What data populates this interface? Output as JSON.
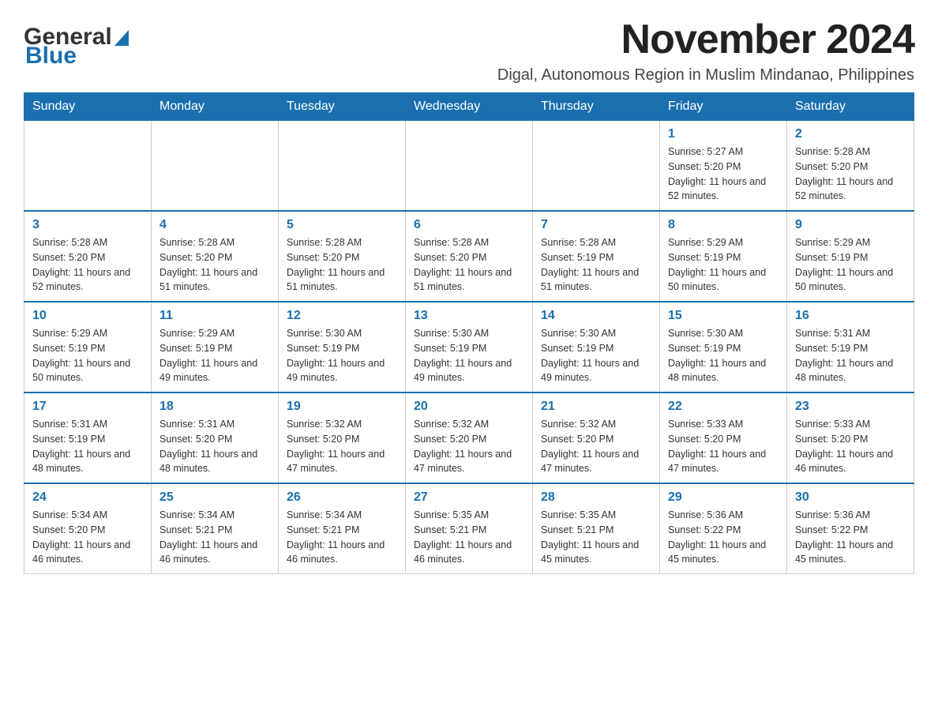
{
  "logo": {
    "line1": "General",
    "line2": "Blue"
  },
  "header": {
    "title": "November 2024",
    "subtitle": "Digal, Autonomous Region in Muslim Mindanao, Philippines"
  },
  "calendar": {
    "days_of_week": [
      "Sunday",
      "Monday",
      "Tuesday",
      "Wednesday",
      "Thursday",
      "Friday",
      "Saturday"
    ],
    "weeks": [
      [
        {
          "day": "",
          "info": ""
        },
        {
          "day": "",
          "info": ""
        },
        {
          "day": "",
          "info": ""
        },
        {
          "day": "",
          "info": ""
        },
        {
          "day": "",
          "info": ""
        },
        {
          "day": "1",
          "info": "Sunrise: 5:27 AM\nSunset: 5:20 PM\nDaylight: 11 hours and 52 minutes."
        },
        {
          "day": "2",
          "info": "Sunrise: 5:28 AM\nSunset: 5:20 PM\nDaylight: 11 hours and 52 minutes."
        }
      ],
      [
        {
          "day": "3",
          "info": "Sunrise: 5:28 AM\nSunset: 5:20 PM\nDaylight: 11 hours and 52 minutes."
        },
        {
          "day": "4",
          "info": "Sunrise: 5:28 AM\nSunset: 5:20 PM\nDaylight: 11 hours and 51 minutes."
        },
        {
          "day": "5",
          "info": "Sunrise: 5:28 AM\nSunset: 5:20 PM\nDaylight: 11 hours and 51 minutes."
        },
        {
          "day": "6",
          "info": "Sunrise: 5:28 AM\nSunset: 5:20 PM\nDaylight: 11 hours and 51 minutes."
        },
        {
          "day": "7",
          "info": "Sunrise: 5:28 AM\nSunset: 5:19 PM\nDaylight: 11 hours and 51 minutes."
        },
        {
          "day": "8",
          "info": "Sunrise: 5:29 AM\nSunset: 5:19 PM\nDaylight: 11 hours and 50 minutes."
        },
        {
          "day": "9",
          "info": "Sunrise: 5:29 AM\nSunset: 5:19 PM\nDaylight: 11 hours and 50 minutes."
        }
      ],
      [
        {
          "day": "10",
          "info": "Sunrise: 5:29 AM\nSunset: 5:19 PM\nDaylight: 11 hours and 50 minutes."
        },
        {
          "day": "11",
          "info": "Sunrise: 5:29 AM\nSunset: 5:19 PM\nDaylight: 11 hours and 49 minutes."
        },
        {
          "day": "12",
          "info": "Sunrise: 5:30 AM\nSunset: 5:19 PM\nDaylight: 11 hours and 49 minutes."
        },
        {
          "day": "13",
          "info": "Sunrise: 5:30 AM\nSunset: 5:19 PM\nDaylight: 11 hours and 49 minutes."
        },
        {
          "day": "14",
          "info": "Sunrise: 5:30 AM\nSunset: 5:19 PM\nDaylight: 11 hours and 49 minutes."
        },
        {
          "day": "15",
          "info": "Sunrise: 5:30 AM\nSunset: 5:19 PM\nDaylight: 11 hours and 48 minutes."
        },
        {
          "day": "16",
          "info": "Sunrise: 5:31 AM\nSunset: 5:19 PM\nDaylight: 11 hours and 48 minutes."
        }
      ],
      [
        {
          "day": "17",
          "info": "Sunrise: 5:31 AM\nSunset: 5:19 PM\nDaylight: 11 hours and 48 minutes."
        },
        {
          "day": "18",
          "info": "Sunrise: 5:31 AM\nSunset: 5:20 PM\nDaylight: 11 hours and 48 minutes."
        },
        {
          "day": "19",
          "info": "Sunrise: 5:32 AM\nSunset: 5:20 PM\nDaylight: 11 hours and 47 minutes."
        },
        {
          "day": "20",
          "info": "Sunrise: 5:32 AM\nSunset: 5:20 PM\nDaylight: 11 hours and 47 minutes."
        },
        {
          "day": "21",
          "info": "Sunrise: 5:32 AM\nSunset: 5:20 PM\nDaylight: 11 hours and 47 minutes."
        },
        {
          "day": "22",
          "info": "Sunrise: 5:33 AM\nSunset: 5:20 PM\nDaylight: 11 hours and 47 minutes."
        },
        {
          "day": "23",
          "info": "Sunrise: 5:33 AM\nSunset: 5:20 PM\nDaylight: 11 hours and 46 minutes."
        }
      ],
      [
        {
          "day": "24",
          "info": "Sunrise: 5:34 AM\nSunset: 5:20 PM\nDaylight: 11 hours and 46 minutes."
        },
        {
          "day": "25",
          "info": "Sunrise: 5:34 AM\nSunset: 5:21 PM\nDaylight: 11 hours and 46 minutes."
        },
        {
          "day": "26",
          "info": "Sunrise: 5:34 AM\nSunset: 5:21 PM\nDaylight: 11 hours and 46 minutes."
        },
        {
          "day": "27",
          "info": "Sunrise: 5:35 AM\nSunset: 5:21 PM\nDaylight: 11 hours and 46 minutes."
        },
        {
          "day": "28",
          "info": "Sunrise: 5:35 AM\nSunset: 5:21 PM\nDaylight: 11 hours and 45 minutes."
        },
        {
          "day": "29",
          "info": "Sunrise: 5:36 AM\nSunset: 5:22 PM\nDaylight: 11 hours and 45 minutes."
        },
        {
          "day": "30",
          "info": "Sunrise: 5:36 AM\nSunset: 5:22 PM\nDaylight: 11 hours and 45 minutes."
        }
      ]
    ]
  }
}
